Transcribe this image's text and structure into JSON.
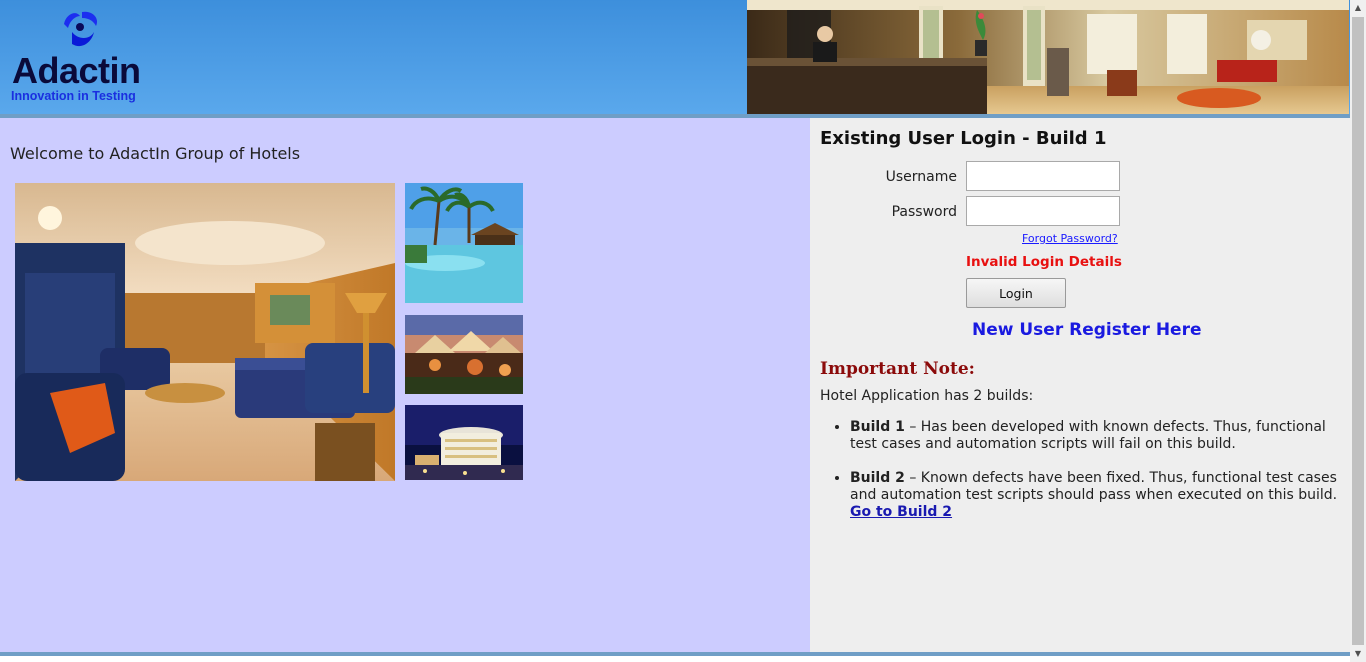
{
  "header": {
    "logo_name": "Adactin",
    "logo_tagline": "Innovation in Testing"
  },
  "left": {
    "welcome": "Welcome to AdactIn Group of Hotels"
  },
  "login": {
    "title": "Existing User Login - Build 1",
    "username_label": "Username",
    "password_label": "Password",
    "username_value": "",
    "password_value": "",
    "forgot_password": "Forgot Password?",
    "error_message": "Invalid Login Details",
    "login_button": "Login",
    "register_link": "New User Register Here"
  },
  "note": {
    "title": "Important Note:",
    "intro": "Hotel Application has 2 builds:",
    "items": [
      {
        "label": "Build 1",
        "text": " – Has been developed with known defects. Thus, functional test cases and automation scripts will fail on this build."
      },
      {
        "label": "Build 2",
        "text": " – Known defects have been fixed. Thus, functional test cases and automation test scripts should pass when executed on this build.",
        "link": "Go to Build 2"
      }
    ]
  },
  "colors": {
    "header_blue": "#4a9be4",
    "left_panel": "#ccccff",
    "right_panel": "#eeeeee",
    "error_red": "#e81010",
    "note_title": "#8b0a0a",
    "link_blue": "#1a1ae0"
  }
}
